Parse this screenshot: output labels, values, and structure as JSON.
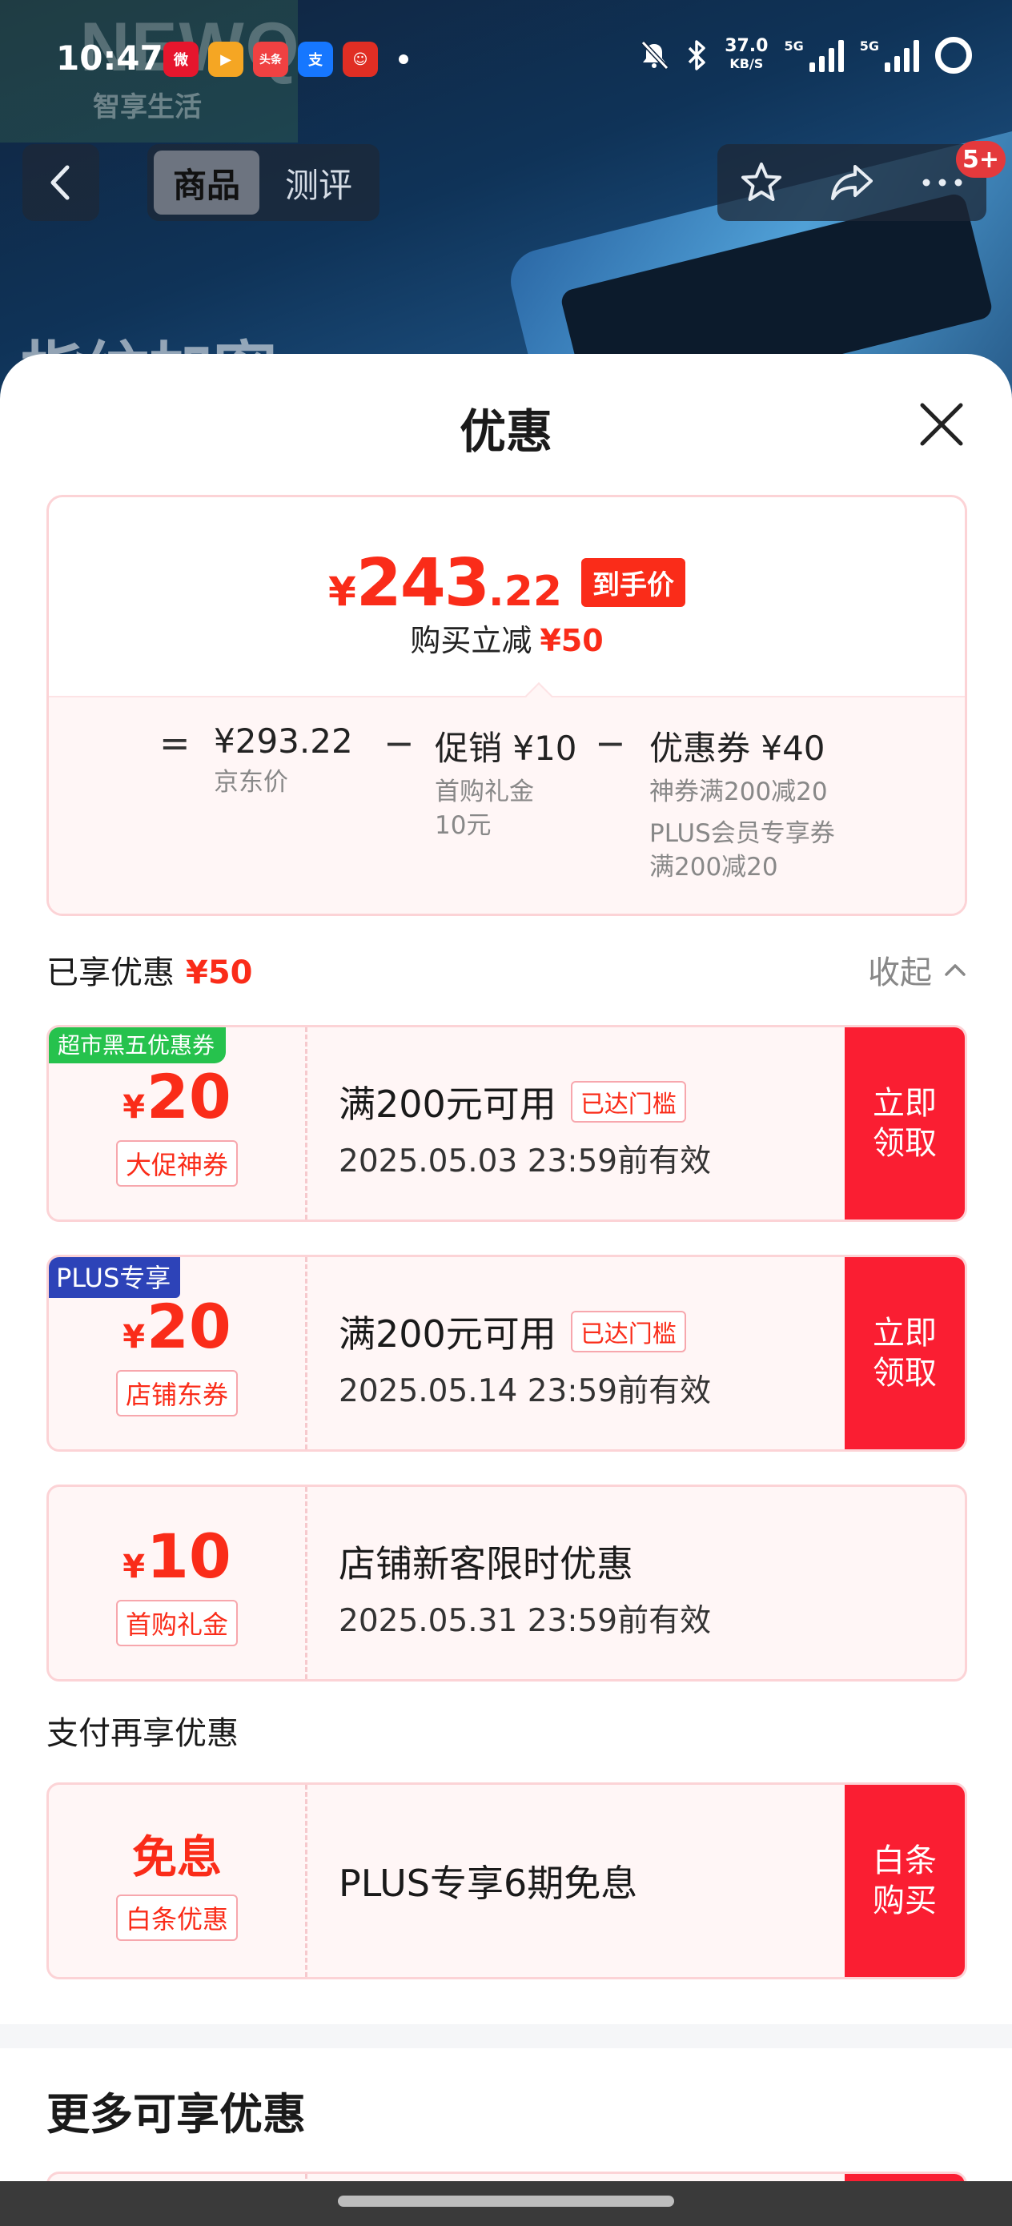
{
  "status_bar": {
    "time": "10:47",
    "app_icons": [
      {
        "name": "weibo-icon",
        "glyph": "微",
        "color": "#e6162d"
      },
      {
        "name": "video-app-icon",
        "glyph": "▶",
        "color": "#f5a623"
      },
      {
        "name": "toutiao-icon",
        "glyph": "头条",
        "color": "#f04142"
      },
      {
        "name": "alipay-icon",
        "glyph": "支",
        "color": "#1677ff"
      },
      {
        "name": "pinduoduo-icon",
        "glyph": "☺",
        "color": "#e02e24"
      }
    ],
    "net_speed": "37.0",
    "net_unit": "KB/S",
    "signal_label_1": "5G",
    "signal_label_2": "5G"
  },
  "background": {
    "brand": "NEWQ",
    "brand_sub": "智享生活",
    "headline": "指纹加密"
  },
  "nav": {
    "tabs": [
      {
        "label": "商品",
        "active": true
      },
      {
        "label": "测评",
        "active": false
      }
    ],
    "badge": "5+"
  },
  "sheet": {
    "title": "优惠",
    "price_card": {
      "yen": "¥",
      "price_int": "243",
      "price_dec": ".22",
      "price_tag": "到手价",
      "sub_label": "购买立减",
      "sub_value": "¥50",
      "breakdown": {
        "eq": "=",
        "minus": "−",
        "jd_price": "¥293.22",
        "jd_label": "京东价",
        "promo_value": "促销 ¥10",
        "promo_label": "首购礼金\n10元",
        "coupon_value": "优惠券 ¥40",
        "coupon_label_1": "神券满200减20",
        "coupon_label_2": "PLUS会员专享券\n满200减20"
      }
    },
    "enjoyed_section": {
      "title": "已享优惠",
      "amount": "¥50",
      "collapse_label": "收起"
    },
    "coupons": [
      {
        "corner_tag": "超市黑五优惠券",
        "corner_style": "green",
        "yen": "¥",
        "amount": "20",
        "type": "大促神券",
        "condition": "满200元可用",
        "condition_tag": "已达门槛",
        "validity": "2025.05.03 23:59前有效",
        "button": "立即\n领取"
      },
      {
        "corner_tag": "PLUS专享",
        "corner_style": "blue",
        "yen": "¥",
        "amount": "20",
        "type": "店铺东券",
        "condition": "满200元可用",
        "condition_tag": "已达门槛",
        "validity": "2025.05.14 23:59前有效",
        "button": "立即\n领取"
      },
      {
        "yen": "¥",
        "amount": "10",
        "type": "首购礼金",
        "condition": "店铺新客限时优惠",
        "validity": "2025.05.31 23:59前有效"
      }
    ],
    "payment_section": {
      "title": "支付再享优惠",
      "card": {
        "amount_text": "免息",
        "type": "白条优惠",
        "condition": "PLUS专享6期免息",
        "button": "白条\n购买"
      }
    },
    "more_title": "更多可享优惠"
  },
  "colors": {
    "accent_red": "#fa2c19",
    "button_red": "#fa1e32",
    "plus_blue": "#2d43b8",
    "green_tag": "#26c24d"
  }
}
